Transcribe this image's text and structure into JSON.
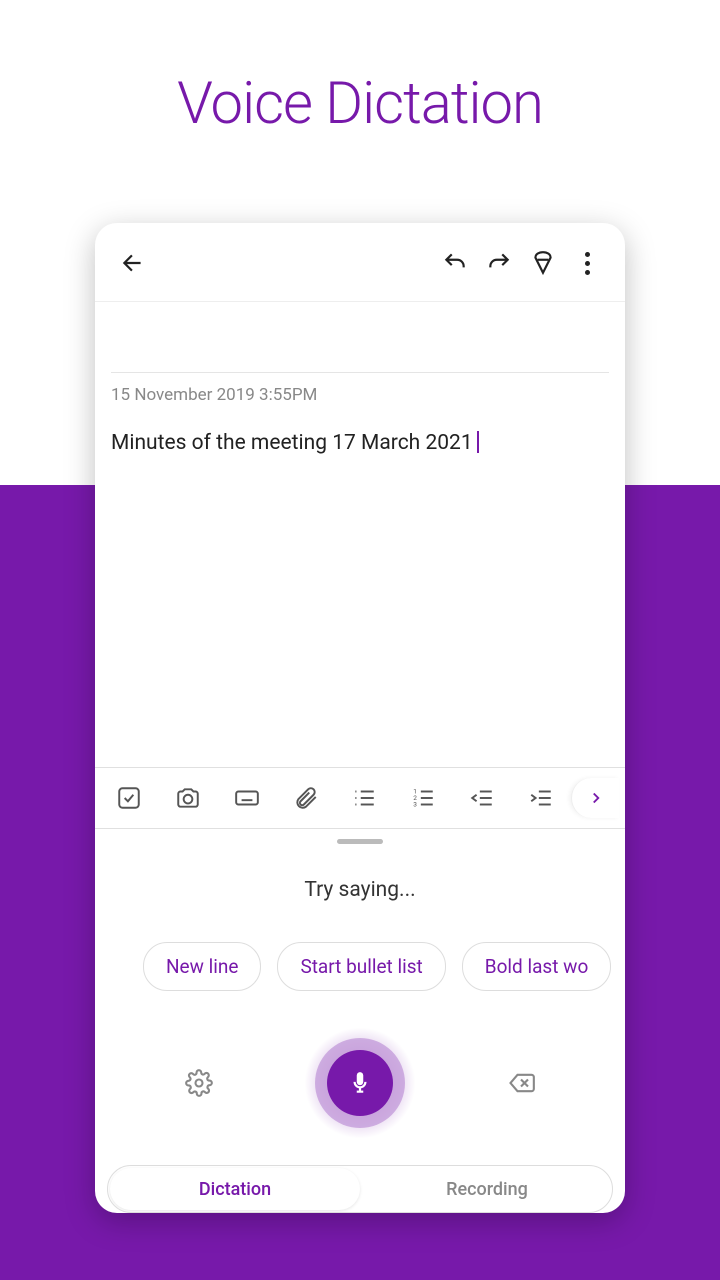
{
  "headline": "Voice Dictation",
  "note": {
    "timestamp": "15 November 2019 3:55PM",
    "body": "Minutes of the meeting 17 March 2021"
  },
  "dictation": {
    "prompt": "Try saying...",
    "suggestions": [
      "New line",
      "Start bullet list",
      "Bold last wo"
    ],
    "tabs": {
      "active": "Dictation",
      "inactive": "Recording"
    }
  }
}
